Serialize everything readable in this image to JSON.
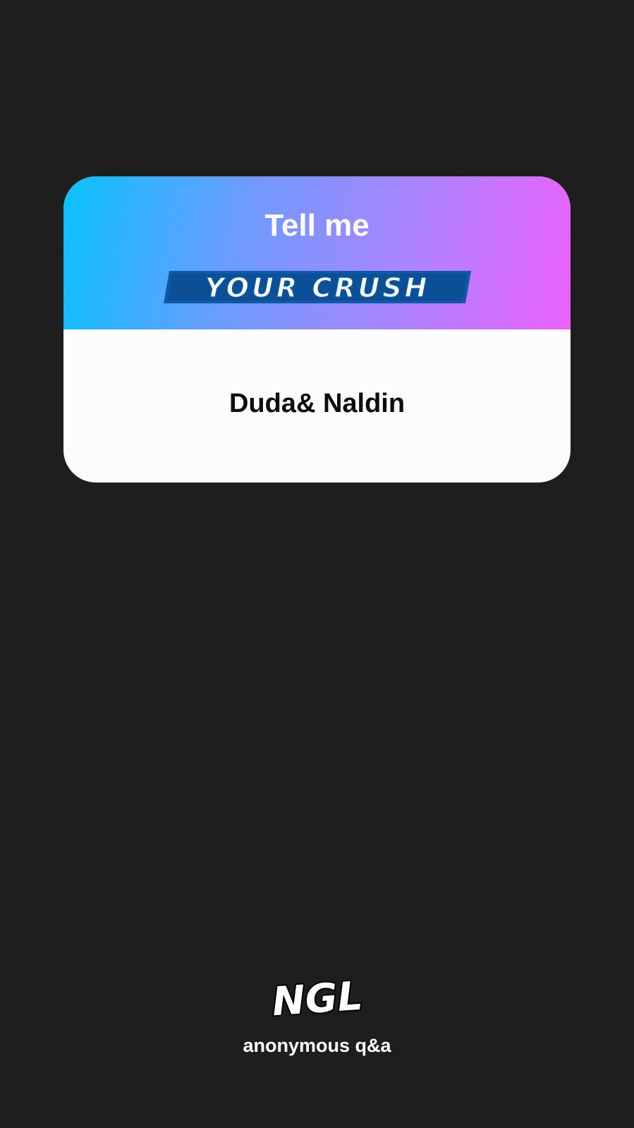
{
  "card": {
    "header_title": "Tell me",
    "badge_text": "YOUR CRUSH",
    "answer": "Duda& Naldin"
  },
  "footer": {
    "logo_text": "NGL",
    "tagline": "anonymous q&a"
  },
  "colors": {
    "background": "#1e1e1e",
    "gradient_start": "#0ac2ff",
    "gradient_end": "#ec61ff",
    "badge_fill": "#ffffff",
    "badge_outline": "#0d5aa7",
    "card_body": "#fcfcfd",
    "answer_text": "#0d0d0d"
  },
  "icons": {
    "brand_logo": "ngl-logo-icon"
  }
}
